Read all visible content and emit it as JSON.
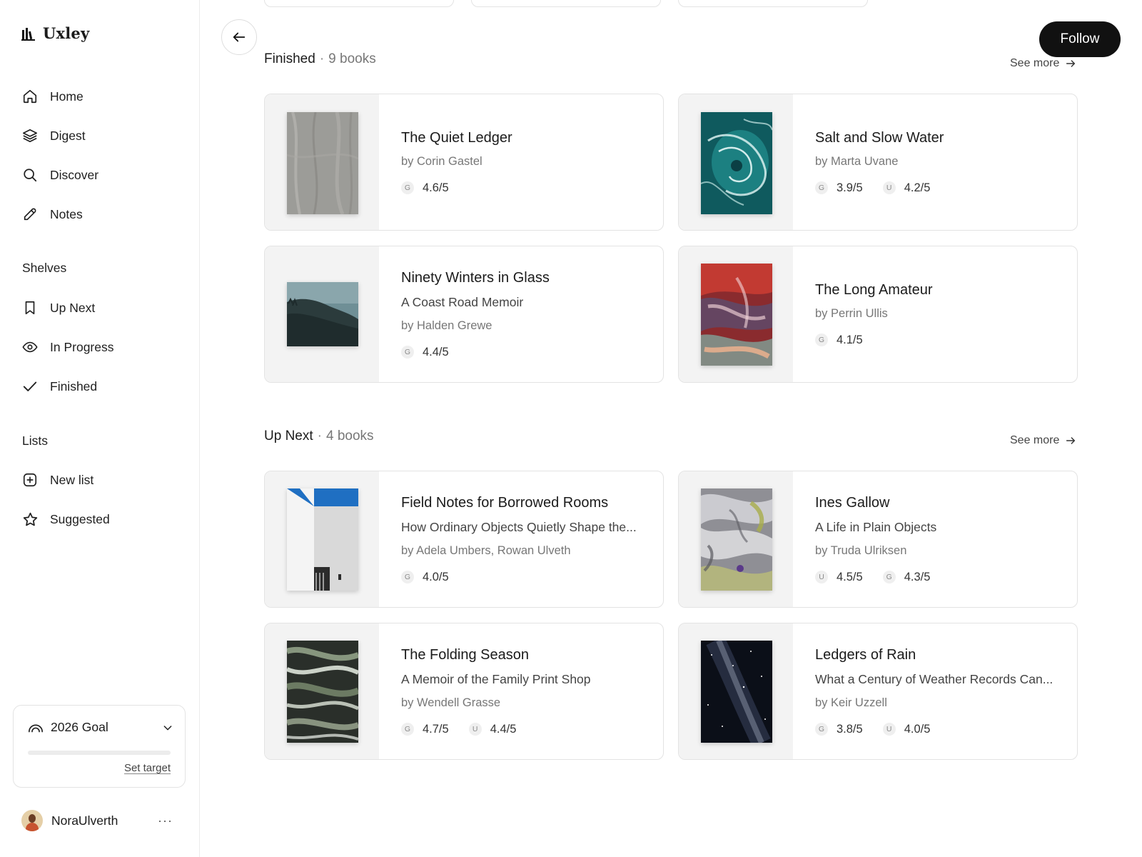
{
  "app": {
    "name": "Uxley"
  },
  "sidebar": {
    "nav": [
      {
        "label": "Home",
        "icon": "home-icon"
      },
      {
        "label": "Digest",
        "icon": "layers-icon"
      },
      {
        "label": "Discover",
        "icon": "search-icon"
      },
      {
        "label": "Notes",
        "icon": "pencil-icon"
      }
    ],
    "shelves_label": "Shelves",
    "shelves": [
      {
        "label": "Up Next",
        "icon": "bookmark-icon"
      },
      {
        "label": "In Progress",
        "icon": "eye-icon"
      },
      {
        "label": "Finished",
        "icon": "check-icon"
      }
    ],
    "lists_label": "Lists",
    "lists": [
      {
        "label": "New list",
        "icon": "plus-square-icon"
      },
      {
        "label": "Suggested",
        "icon": "star-icon"
      }
    ],
    "goal": {
      "title": "2026 Goal",
      "progress": 0,
      "set_target": "Set target"
    },
    "user": {
      "name": "NoraUlverth",
      "more": "···"
    }
  },
  "main": {
    "follow_label": "Follow",
    "sections": [
      {
        "title": "Finished",
        "separator": "·",
        "count": "9 books",
        "see_more": "See more",
        "books": [
          {
            "title": "The Quiet Ledger",
            "subtitle": "",
            "author": "by Corin Gastel",
            "ratings": [
              {
                "source": "G",
                "value": "4.6/5"
              }
            ],
            "cover": "linen"
          },
          {
            "title": "Salt and Slow Water",
            "subtitle": "",
            "author": "by Marta Uvane",
            "ratings": [
              {
                "source": "G",
                "value": "3.9/5"
              },
              {
                "source": "U",
                "value": "4.2/5"
              }
            ],
            "cover": "ocean"
          },
          {
            "title": "Ninety Winters in Glass",
            "subtitle": "A Coast Road Memoir",
            "author": "by Halden Grewe",
            "ratings": [
              {
                "source": "G",
                "value": "4.4/5"
              }
            ],
            "cover": "hills"
          },
          {
            "title": "The Long Amateur",
            "subtitle": "",
            "author": "by Perrin Ullis",
            "ratings": [
              {
                "source": "G",
                "value": "4.1/5"
              }
            ],
            "cover": "paint"
          }
        ]
      },
      {
        "title": "Up Next",
        "separator": "·",
        "count": "4 books",
        "see_more": "See more",
        "books": [
          {
            "title": "Field Notes for Borrowed Rooms",
            "subtitle": "How Ordinary Objects Quietly Shape the...",
            "author": "by Adela Umbers, Rowan Ulveth",
            "ratings": [
              {
                "source": "G",
                "value": "4.0/5"
              }
            ],
            "cover": "building"
          },
          {
            "title": "Ines Gallow",
            "subtitle": "A Life in Plain Objects",
            "author": "by Truda Ulriksen",
            "ratings": [
              {
                "source": "U",
                "value": "4.5/5"
              },
              {
                "source": "G",
                "value": "4.3/5"
              }
            ],
            "cover": "marble"
          },
          {
            "title": "The Folding Season",
            "subtitle": "A Memoir of the Family Print Shop",
            "author": "by Wendell Grasse",
            "ratings": [
              {
                "source": "G",
                "value": "4.7/5"
              },
              {
                "source": "U",
                "value": "4.4/5"
              }
            ],
            "cover": "swirl"
          },
          {
            "title": "Ledgers of Rain",
            "subtitle": "What a Century of Weather Records Can...",
            "author": "by Keir Uzzell",
            "ratings": [
              {
                "source": "G",
                "value": "3.8/5"
              },
              {
                "source": "U",
                "value": "4.0/5"
              }
            ],
            "cover": "galaxy"
          }
        ]
      }
    ]
  }
}
